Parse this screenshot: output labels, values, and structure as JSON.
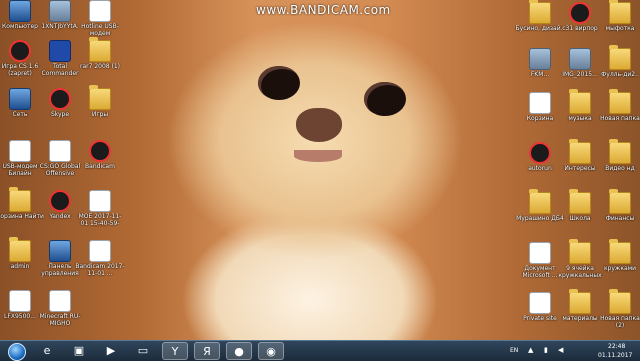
{
  "watermark": "www.BANDICAM.com",
  "desktop_icons": [
    {
      "id": "computer",
      "label": "Компьютер",
      "icon": "computer-icon",
      "kind": "pc"
    },
    {
      "id": "pic1",
      "label": "1XNTJbYYtA.",
      "icon": "image-file-icon",
      "kind": "pic"
    },
    {
      "id": "hotline",
      "label": "Hotline USB-модем",
      "icon": "modem-icon",
      "kind": "file"
    },
    {
      "id": "game-cs",
      "label": "Игра CS 1.6 (zapret)",
      "icon": "counter-strike-icon",
      "kind": "round"
    },
    {
      "id": "total-commander",
      "label": "Total Commander",
      "icon": "floppy-disk-icon",
      "kind": "disk"
    },
    {
      "id": "rar",
      "label": "rar7 2008 (1)",
      "icon": "archive-icon",
      "kind": "folder"
    },
    {
      "id": "network",
      "label": "Сеть",
      "icon": "network-icon",
      "kind": "pc"
    },
    {
      "id": "skype",
      "label": "Skype",
      "icon": "skype-icon",
      "kind": "round"
    },
    {
      "id": "games-folder",
      "label": "Игры",
      "icon": "folder-icon",
      "kind": "folder"
    },
    {
      "id": "modem",
      "label": "USB-модем Билайн",
      "icon": "usb-modem-icon",
      "kind": "file"
    },
    {
      "id": "csgo",
      "label": "CS:GO Global Offensive",
      "icon": "csgo-icon",
      "kind": "file"
    },
    {
      "id": "bandicam",
      "label": "Bandicam",
      "icon": "bandicam-icon",
      "kind": "round"
    },
    {
      "id": "cart",
      "label": "Корзина Найти",
      "icon": "folder-icon",
      "kind": "folder"
    },
    {
      "id": "yandex",
      "label": "Yandex",
      "icon": "yandex-icon",
      "kind": "round"
    },
    {
      "id": "video1",
      "label": "МОЁ 2017-11-01 15-40-59-869",
      "icon": "video-file-icon",
      "kind": "file"
    },
    {
      "id": "admin",
      "label": "admin",
      "icon": "folder-icon",
      "kind": "folder"
    },
    {
      "id": "control-panel",
      "label": "Панель управления",
      "icon": "control-panel-icon",
      "kind": "pc"
    },
    {
      "id": "video2",
      "label": "Bandicam 2017-11-01 ...",
      "icon": "video-file-icon",
      "kind": "file"
    },
    {
      "id": "phone",
      "label": "LFX9500...",
      "icon": "phone-icon",
      "kind": "file"
    },
    {
      "id": "minecraft",
      "label": "Minecraft RU-MIGHO",
      "icon": "minecraft-icon",
      "kind": "file"
    },
    {
      "id": "r-screen",
      "label": "Бусино, дизай..",
      "icon": "folder-icon",
      "kind": "folder"
    },
    {
      "id": "r-canon",
      "label": "c31 вирпор",
      "icon": "camera-icon",
      "kind": "round"
    },
    {
      "id": "r-mice",
      "label": "мыфотка",
      "icon": "folder-icon",
      "kind": "folder"
    },
    {
      "id": "r-photo1",
      "label": "FKM...",
      "icon": "image-file-icon",
      "kind": "pic"
    },
    {
      "id": "r-photo2",
      "label": "IMG_2015...",
      "icon": "image-file-icon",
      "kind": "pic"
    },
    {
      "id": "r-folder1",
      "label": "Фулль-ди2..",
      "icon": "folder-icon",
      "kind": "folder"
    },
    {
      "id": "r-recycle",
      "label": "Корзина",
      "icon": "recycle-bin-icon",
      "kind": "file"
    },
    {
      "id": "r-music",
      "label": "музыка",
      "icon": "folder-icon",
      "kind": "folder"
    },
    {
      "id": "r-new",
      "label": "Новая папка",
      "icon": "folder-icon",
      "kind": "folder"
    },
    {
      "id": "r-4",
      "label": "autorun",
      "icon": "channel-four-icon",
      "kind": "round"
    },
    {
      "id": "r-folder2",
      "label": "Интересы",
      "icon": "folder-icon",
      "kind": "folder"
    },
    {
      "id": "r-folder3",
      "label": "Видео нд",
      "icon": "folder-icon",
      "kind": "folder"
    },
    {
      "id": "r-folder4",
      "label": "Мурашино ДБ4",
      "icon": "folder-icon",
      "kind": "folder"
    },
    {
      "id": "r-folder5",
      "label": "Школа",
      "icon": "folder-icon",
      "kind": "folder"
    },
    {
      "id": "r-folder6",
      "label": "Финансы",
      "icon": "folder-icon",
      "kind": "folder"
    },
    {
      "id": "r-doc",
      "label": "Документ Microsoft ...",
      "icon": "document-icon",
      "kind": "file"
    },
    {
      "id": "r-folder7",
      "label": "9 ячейка кружкальных",
      "icon": "folder-icon",
      "kind": "folder"
    },
    {
      "id": "r-folder8",
      "label": "кружками",
      "icon": "folder-icon",
      "kind": "folder"
    },
    {
      "id": "r-private",
      "label": "Private site",
      "icon": "zip-icon",
      "kind": "file"
    },
    {
      "id": "r-folder9",
      "label": "материалы",
      "icon": "folder-icon",
      "kind": "folder"
    },
    {
      "id": "r-folder10",
      "label": "Новая папка (2)",
      "icon": "folder-icon",
      "kind": "folder"
    }
  ],
  "taskbar": {
    "items": [
      {
        "id": "ie",
        "icon": "internet-explorer-icon",
        "glyph": "e"
      },
      {
        "id": "explorer",
        "icon": "file-explorer-icon",
        "glyph": "▣"
      },
      {
        "id": "media",
        "icon": "media-player-icon",
        "glyph": "▶"
      },
      {
        "id": "folder",
        "icon": "folder-icon",
        "glyph": "▭"
      },
      {
        "id": "yandex",
        "icon": "yandex-browser-icon",
        "glyph": "Y"
      },
      {
        "id": "yandex2",
        "icon": "yandex-icon",
        "glyph": "Я"
      },
      {
        "id": "bandicam",
        "icon": "bandicam-record-icon",
        "glyph": "●"
      },
      {
        "id": "cs",
        "icon": "counter-strike-icon",
        "glyph": "◉"
      }
    ],
    "language": "EN",
    "time": "22:48",
    "date": "01.11.2017"
  },
  "colors": {
    "taskbar": "#1c2b3b",
    "wallpaper": "#c98450"
  }
}
